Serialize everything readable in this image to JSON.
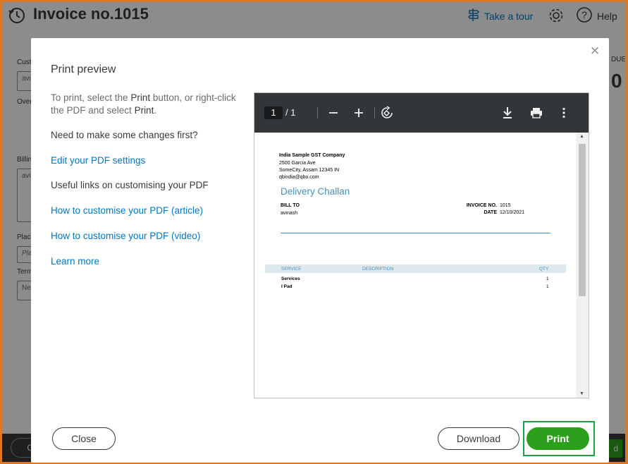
{
  "app": {
    "title": "Invoice no.1015",
    "take_tour": "Take a tour",
    "help": "Help",
    "bg_labels": [
      "Cust",
      "Over",
      "Billin",
      "Place",
      "Term"
    ],
    "bg_values": [
      "avi",
      "avi",
      "Pla",
      "Ne"
    ],
    "bg_right_lbl": "DUE",
    "bg_right_val": "0",
    "bg_cancel": "Ca",
    "bg_save": "d"
  },
  "modal": {
    "title": "Print preview",
    "intro_prefix": "To print, select the ",
    "intro_bold1": "Print",
    "intro_mid": " button, or right-click the PDF and select ",
    "intro_bold2": "Print",
    "intro_suffix": ".",
    "changes_heading": "Need to make some changes first?",
    "edit_link": "Edit your PDF settings",
    "useful_heading": "Useful links on customising your PDF",
    "article_link": "How to customise your PDF (article)",
    "video_link": "How to customise your PDF (video)",
    "learn_more": "Learn more",
    "close_button": "Close",
    "download_button": "Download",
    "print_button": "Print"
  },
  "pdf_viewer": {
    "current_page": "1",
    "total_pages": "/ 1",
    "icons": [
      "zoom-out-icon",
      "zoom-in-icon",
      "rotate-icon",
      "download-icon",
      "print-icon",
      "more-icon"
    ]
  },
  "document": {
    "company": "India Sample GST Company",
    "address1": "2500 Garcia Ave",
    "address2": "SomeCity, Assam  12345 IN",
    "email": "qbindia@qbo.com",
    "title": "Delivery Challan",
    "bill_to_label": "BILL TO",
    "bill_to_name": "avinash",
    "invoice_no_label": "INVOICE NO.",
    "invoice_no": "1015",
    "date_label": "DATE",
    "date": "12/10/2021",
    "columns": [
      "SERVICE",
      "DESCRIPTION",
      "QTY"
    ],
    "rows": [
      {
        "service": "Services",
        "qty": "1"
      },
      {
        "service": "I Pad",
        "qty": "1"
      }
    ]
  },
  "colors": {
    "accent_green": "#2ca01c",
    "link_blue": "#0077c5",
    "highlight_border": "#1fa33e",
    "frame_orange": "#d97a2a"
  }
}
